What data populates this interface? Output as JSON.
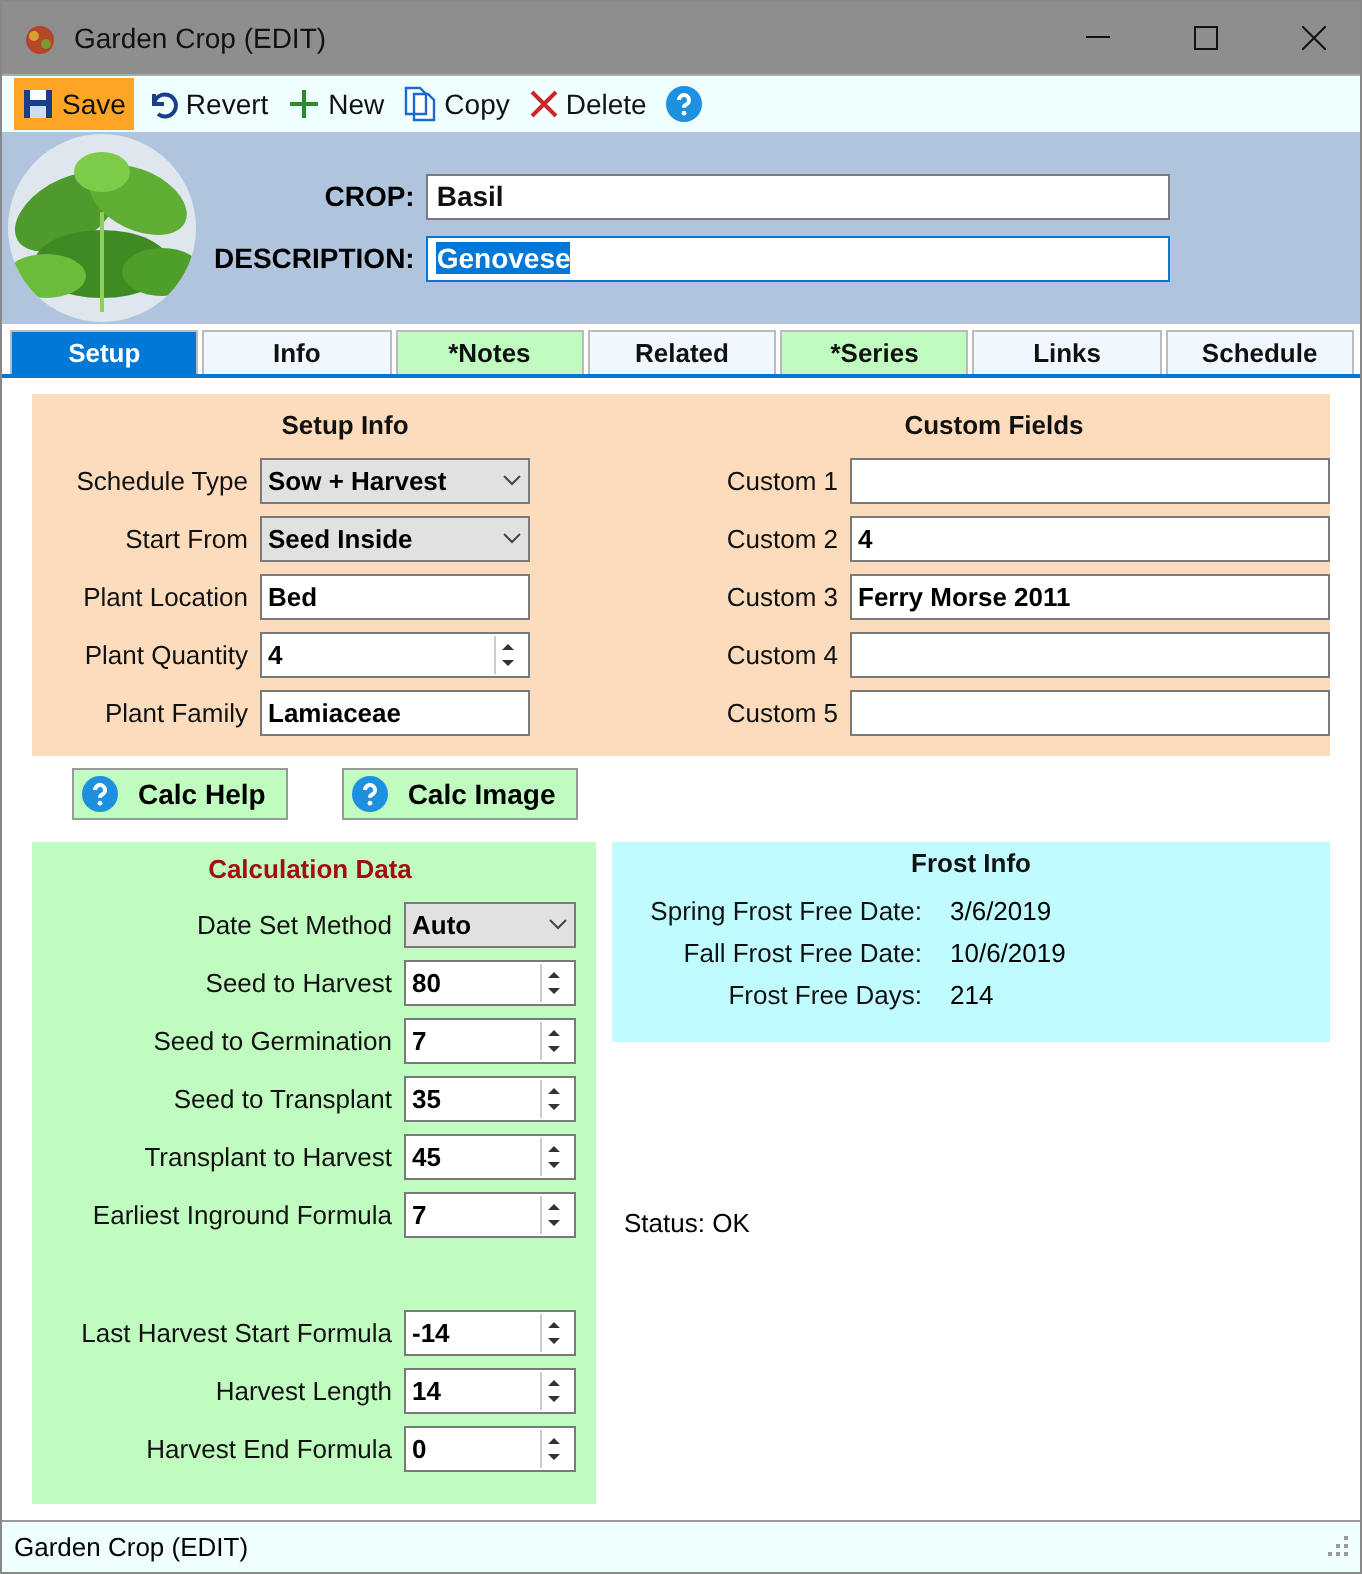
{
  "window": {
    "title": "Garden Crop (EDIT)"
  },
  "toolbar": [
    {
      "label": "Save",
      "kind": "save",
      "highlighted": true
    },
    {
      "label": "Revert",
      "kind": "revert",
      "highlighted": false
    },
    {
      "label": "New",
      "kind": "new",
      "highlighted": false
    },
    {
      "label": "Copy",
      "kind": "copy",
      "highlighted": false
    },
    {
      "label": "Delete",
      "kind": "delete",
      "highlighted": false
    },
    {
      "kind": "help",
      "highlighted": false
    }
  ],
  "header": {
    "fields": [
      {
        "label": "CROP:",
        "value": "Basil",
        "text_selected": false
      },
      {
        "label": "DESCRIPTION:",
        "value": "Genovese",
        "text_selected": true
      }
    ]
  },
  "tabs": [
    {
      "label": "Setup",
      "selected": true,
      "highlighted": false
    },
    {
      "label": "Info",
      "selected": false,
      "highlighted": false
    },
    {
      "label": "*Notes",
      "selected": false,
      "highlighted": true
    },
    {
      "label": "Related",
      "selected": false,
      "highlighted": false
    },
    {
      "label": "*Series",
      "selected": false,
      "highlighted": true
    },
    {
      "label": "Links",
      "selected": false,
      "highlighted": false
    },
    {
      "label": "Schedule",
      "selected": false,
      "highlighted": false
    }
  ],
  "setup_info": {
    "title": "Setup Info",
    "fields": [
      {
        "label": "Schedule Type",
        "value": "Sow + Harvest",
        "kind": "dropdown"
      },
      {
        "label": "Start From",
        "value": "Seed Inside",
        "kind": "dropdown"
      },
      {
        "label": "Plant Location",
        "value": "Bed",
        "kind": "text"
      },
      {
        "label": "Plant Quantity",
        "value": "4",
        "kind": "spin"
      },
      {
        "label": "Plant Family",
        "value": "Lamiaceae",
        "kind": "text"
      }
    ]
  },
  "custom_fields": {
    "title": "Custom Fields",
    "fields": [
      {
        "label": "Custom 1"
      },
      {
        "label": "Custom 2",
        "value": "4"
      },
      {
        "label": "Custom 3",
        "value": "Ferry Morse 2011"
      },
      {
        "label": "Custom 4"
      },
      {
        "label": "Custom 5"
      }
    ]
  },
  "buttons": [
    {
      "label": "Calc Help"
    },
    {
      "label": "Calc Image"
    }
  ],
  "calculation_data": {
    "title": "Calculation Data",
    "fields": [
      {
        "label": "Date Set Method",
        "value": "Auto",
        "kind": "dropdown"
      },
      {
        "label": "Seed to Harvest",
        "value": "80",
        "kind": "spin"
      },
      {
        "label": "Seed to Germination",
        "value": "7",
        "kind": "spin"
      },
      {
        "label": "Seed to Transplant",
        "value": "35",
        "kind": "spin"
      },
      {
        "label": "Transplant to Harvest",
        "value": "45",
        "kind": "spin"
      },
      {
        "label": "Earliest Inground Formula",
        "value": "7",
        "kind": "spin"
      },
      {
        "label": "Last Harvest Start Formula",
        "value": "-14",
        "kind": "spin"
      },
      {
        "label": "Harvest Length",
        "value": "14",
        "kind": "spin"
      },
      {
        "label": "Harvest End Formula",
        "value": "0",
        "kind": "spin"
      }
    ]
  },
  "frost_info": {
    "title": "Frost Info",
    "rows": [
      {
        "label": "Spring Frost Free Date:",
        "value": "3/6/2019"
      },
      {
        "label": "Fall Frost Free Date:",
        "value": "10/6/2019"
      },
      {
        "label": "Frost Free Days:",
        "value": "214"
      }
    ]
  },
  "status": "Status: OK",
  "status_bar": "Garden Crop (EDIT)"
}
